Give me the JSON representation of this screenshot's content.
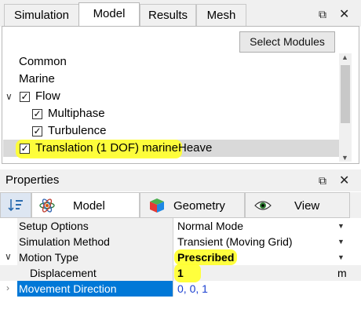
{
  "top_tabs": [
    {
      "label": "Simulation"
    },
    {
      "label": "Model"
    },
    {
      "label": "Results"
    },
    {
      "label": "Mesh"
    }
  ],
  "window_controls": {
    "float_icon": "float-window-icon",
    "close_icon": "close-icon"
  },
  "model_panel": {
    "select_modules_label": "Select Modules",
    "tree": [
      {
        "label": "Common",
        "checkbox": false
      },
      {
        "label": "Marine",
        "checkbox": false
      },
      {
        "label": "Flow",
        "checkbox": true,
        "checked": true,
        "expanded": true
      },
      {
        "label": "Multiphase",
        "checkbox": true,
        "checked": true
      },
      {
        "label": "Turbulence",
        "checkbox": true,
        "checked": true
      },
      {
        "label": "Translation (1 DOF) marineHeave",
        "checkbox": true,
        "checked": true,
        "selected": true,
        "highlighted": true
      }
    ]
  },
  "properties": {
    "title": "Properties",
    "tabs": [
      {
        "label": "Model",
        "icon": "atom-icon"
      },
      {
        "label": "Geometry",
        "icon": "cube-icon"
      },
      {
        "label": "View",
        "icon": "eye-icon"
      }
    ],
    "rows": [
      {
        "name": "Setup Options",
        "value": "Normal Mode"
      },
      {
        "name": "Simulation Method",
        "value": "Transient (Moving Grid)"
      },
      {
        "name": "Motion Type",
        "value": "Prescribed"
      },
      {
        "name": "Displacement",
        "value": "1",
        "unit": "m"
      },
      {
        "name": "Movement Direction",
        "value": "0, 0, 1"
      }
    ]
  },
  "colors": {
    "highlight": "#ffff33",
    "selection_blue": "#0078d7",
    "link_blue": "#1a3fd1"
  }
}
